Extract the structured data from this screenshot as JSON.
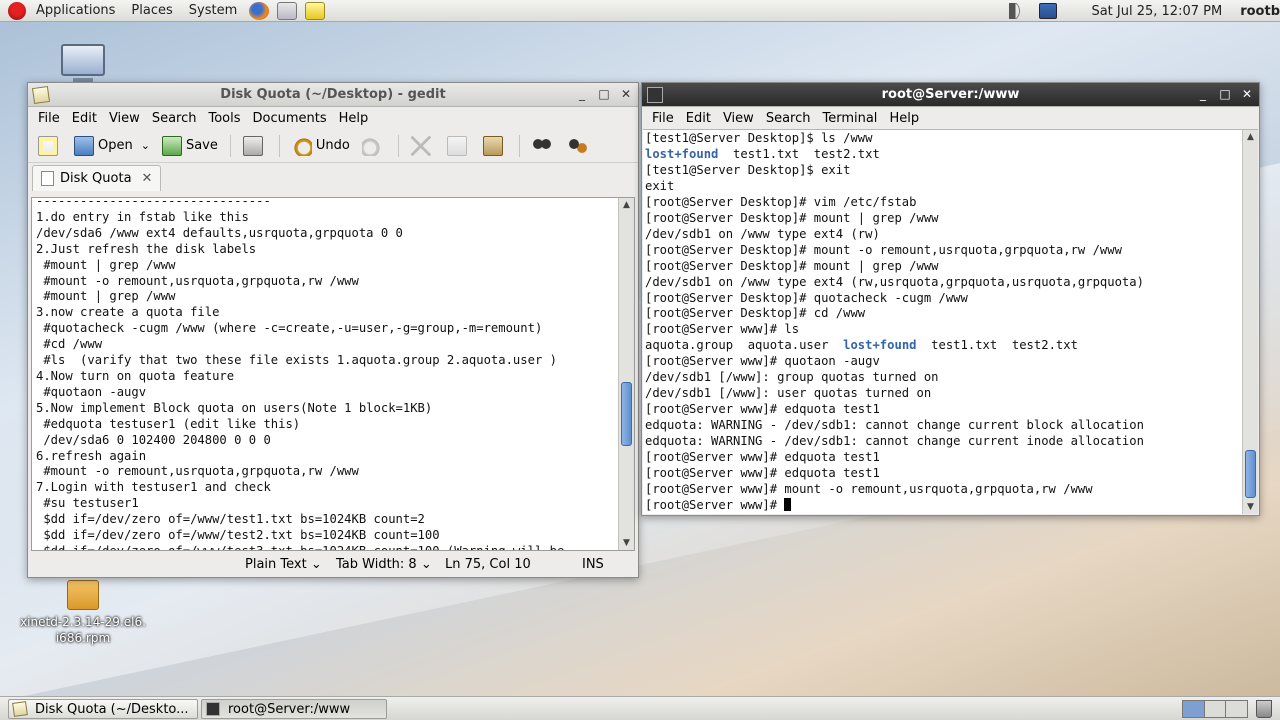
{
  "top_panel": {
    "menus": [
      "Applications",
      "Places",
      "System"
    ],
    "clock": "Sat Jul 25, 12:07 PM",
    "user": "rootb"
  },
  "desktop": {
    "icons": [
      {
        "label": ""
      },
      {
        "label": "xinetd-2.3.14-29.el6.\ni686.rpm"
      }
    ]
  },
  "gedit": {
    "title": "Disk Quota (~/Desktop) - gedit",
    "menu": [
      "File",
      "Edit",
      "View",
      "Search",
      "Tools",
      "Documents",
      "Help"
    ],
    "toolbar": {
      "open": "Open",
      "save": "Save",
      "undo": "Undo"
    },
    "tab": "Disk Quota",
    "lines": [
      "--------------------------------",
      "1.do entry in fstab like this",
      "/dev/sda6 /www ext4 defaults,usrquota,grpquota 0 0",
      "2.Just refresh the disk labels",
      " #mount | grep /www",
      " #mount -o remount,usrquota,grpquota,rw /www",
      " #mount | grep /www",
      "3.now create a quota file",
      " #quotacheck -cugm /www (where -c=create,-u=user,-g=group,-m=remount)",
      " #cd /www",
      " #ls  (varify that two these file exists 1.aquota.group 2.aquota.user )",
      "4.Now turn on quota feature",
      " #quotaon -augv",
      "5.Now implement Block quota on users(Note 1 block=1KB)",
      " #edquota testuser1 (edit like this)",
      " /dev/sda6 0 102400 204800 0 0 0",
      "6.refresh again",
      " #mount -o remount,usrquota,grpquota,rw /www",
      "7.Login with testuser1 and check",
      " #su testuser1",
      " $dd if=/dev/zero of=/www/test1.txt bs=1024KB count=2",
      " $dd if=/dev/zero of=/www/test2.txt bs=1024KB count=100",
      " $dd if=/dev/zero of=/www/test3.txt bs=1024KB count=100 (Warning will be"
    ],
    "status": {
      "mode": "Plain Text",
      "tab_width": "Tab Width:  8",
      "position": "Ln 75, Col 10",
      "ins": "INS"
    }
  },
  "terminal": {
    "title": "root@Server:/www",
    "menu": [
      "File",
      "Edit",
      "View",
      "Search",
      "Terminal",
      "Help"
    ],
    "lines": [
      "[test1@Server Desktop]$ ls /www",
      "__LS1__",
      "[test1@Server Desktop]$ exit",
      "exit",
      "[root@Server Desktop]# vim /etc/fstab",
      "[root@Server Desktop]# mount | grep /www",
      "/dev/sdb1 on /www type ext4 (rw)",
      "[root@Server Desktop]# mount -o remount,usrquota,grpquota,rw /www",
      "[root@Server Desktop]# mount | grep /www",
      "/dev/sdb1 on /www type ext4 (rw,usrquota,grpquota,usrquota,grpquota)",
      "[root@Server Desktop]# quotacheck -cugm /www",
      "[root@Server Desktop]# cd /www",
      "[root@Server www]# ls",
      "__LS2__",
      "[root@Server www]# quotaon -augv",
      "/dev/sdb1 [/www]: group quotas turned on",
      "/dev/sdb1 [/www]: user quotas turned on",
      "[root@Server www]# edquota test1",
      "edquota: WARNING - /dev/sdb1: cannot change current block allocation",
      "edquota: WARNING - /dev/sdb1: cannot change current inode allocation",
      "[root@Server www]# edquota test1",
      "[root@Server www]# edquota test1",
      "[root@Server www]# mount -o remount,usrquota,grpquota,rw /www",
      "[root@Server www]# "
    ],
    "ls1": {
      "dir": "lost+found",
      "rest": "  test1.txt  test2.txt"
    },
    "ls2": {
      "pre": "aquota.group  aquota.user  ",
      "dir": "lost+found",
      "rest": "  test1.txt  test2.txt"
    },
    "dir_color": "#3465a4"
  },
  "taskbar": {
    "items": [
      "Disk Quota (~/Deskto...",
      "root@Server:/www"
    ]
  }
}
